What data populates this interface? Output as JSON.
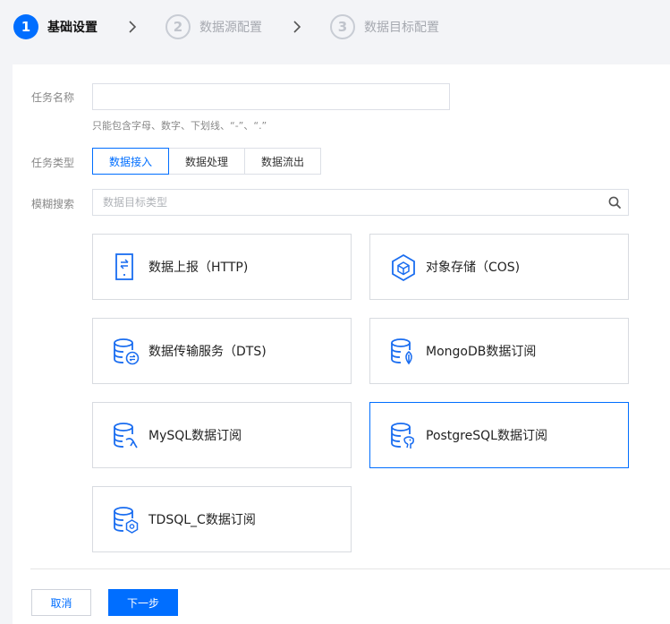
{
  "steps": [
    {
      "number": "1",
      "label": "基础设置",
      "state": "active"
    },
    {
      "number": "2",
      "label": "数据源配置",
      "state": "inactive"
    },
    {
      "number": "3",
      "label": "数据目标配置",
      "state": "inactive"
    }
  ],
  "form": {
    "task_name_label": "任务名称",
    "task_name_value": "",
    "task_name_hint": "只能包含字母、数字、下划线、“-”、“.”",
    "task_type_label": "任务类型",
    "task_types": [
      "数据接入",
      "数据处理",
      "数据流出"
    ],
    "task_type_selected": "数据接入",
    "search_label": "模糊搜索",
    "search_placeholder": "数据目标类型"
  },
  "cards": [
    {
      "label": "数据上报（HTTP)",
      "icon": "http-report-icon",
      "selected": false
    },
    {
      "label": "对象存储（COS)",
      "icon": "cos-cube-icon",
      "selected": false
    },
    {
      "label": "数据传输服务（DTS)",
      "icon": "dts-database-icon",
      "selected": false
    },
    {
      "label": "MongoDB数据订阅",
      "icon": "mongodb-database-icon",
      "selected": false
    },
    {
      "label": "MySQL数据订阅",
      "icon": "mysql-database-icon",
      "selected": false
    },
    {
      "label": "PostgreSQL数据订阅",
      "icon": "postgresql-database-icon",
      "selected": true
    },
    {
      "label": "TDSQL_C数据订阅",
      "icon": "tdsql-database-icon",
      "selected": false
    }
  ],
  "footer": {
    "cancel_label": "取消",
    "next_label": "下一步"
  },
  "colors": {
    "accent": "#006eff",
    "inactive_step": "#c0c4cc",
    "border": "#dcdfe6",
    "background": "#f3f4f7"
  }
}
